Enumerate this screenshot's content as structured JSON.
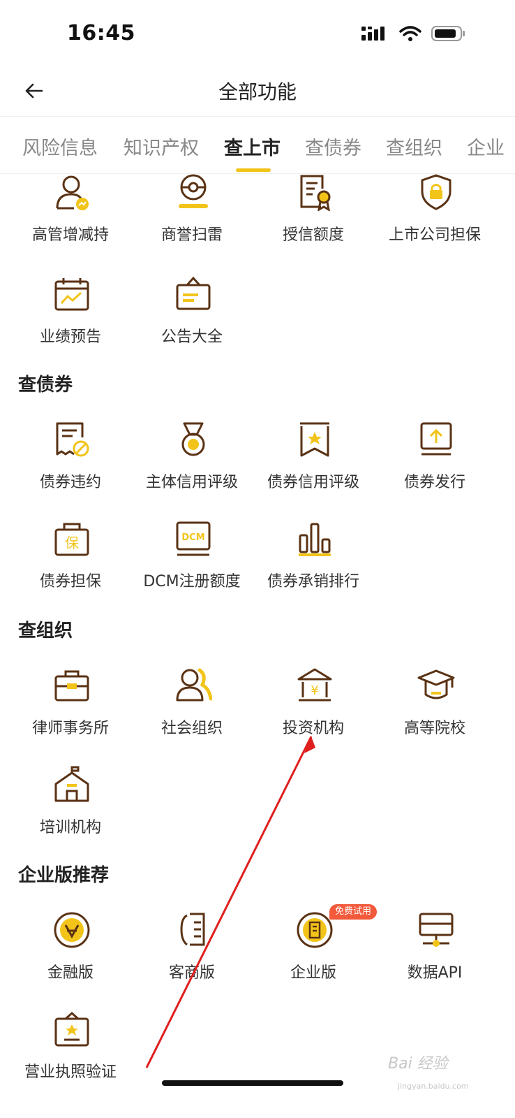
{
  "status": {
    "time": "16:45"
  },
  "nav": {
    "title": "全部功能"
  },
  "tabs": [
    "风险信息",
    "知识产权",
    "查上市",
    "查债券",
    "查组织",
    "企业"
  ],
  "sections": {
    "listed": {
      "items": [
        "高管增减持",
        "商誉扫雷",
        "授信额度",
        "上市公司担保",
        "业绩预告",
        "公告大全"
      ]
    },
    "bonds": {
      "title": "查债券",
      "items": [
        "债券违约",
        "主体信用评级",
        "债券信用评级",
        "债券发行",
        "债券担保",
        "DCM注册额度",
        "债券承销排行"
      ]
    },
    "orgs": {
      "title": "查组织",
      "items": [
        "律师事务所",
        "社会组织",
        "投资机构",
        "高等院校",
        "培训机构"
      ]
    },
    "enterprise": {
      "title": "企业版推荐",
      "items": [
        "金融版",
        "客商版",
        "企业版",
        "数据API",
        "营业执照验证"
      ],
      "badge": "免费试用"
    }
  },
  "watermark": {
    "main": "Bai 经验",
    "sub": "jingyan.baidu.com"
  },
  "colors": {
    "brown": "#5a3214",
    "yellow": "#f2c41a",
    "badge": "#f3593b"
  }
}
